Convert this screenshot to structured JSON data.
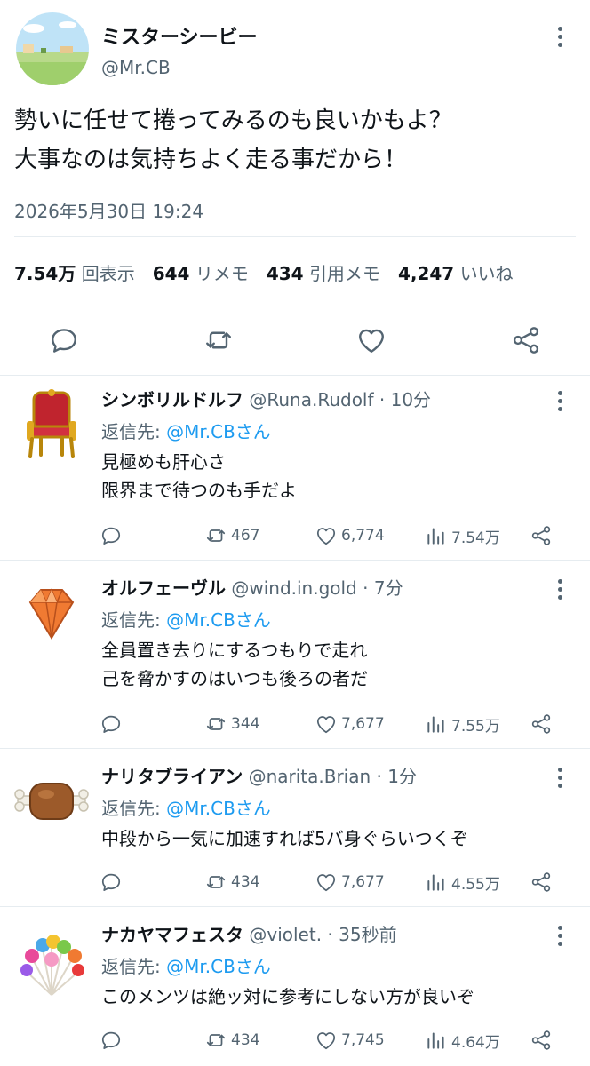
{
  "main": {
    "name": "ミスターシービー",
    "handle": "@Mr.CB",
    "lines": [
      "勢いに任せて捲ってみるのも良いかもよ？",
      "大事なのは気持ちよく走る事だから！"
    ],
    "timestamp": "2026年5月30日 19:24",
    "stats": {
      "views": "7.54万",
      "views_label": "回表示",
      "reposts": "644",
      "reposts_label": "リメモ",
      "quotes": "434",
      "quotes_label": "引用メモ",
      "likes": "4,247",
      "likes_label": "いいね"
    }
  },
  "replies": [
    {
      "name": "シンボリルドルフ",
      "handle": "@Runa.Rudolf",
      "time": "10分",
      "to_prefix": "返信先: ",
      "to": "@Mr.CBさん",
      "lines": [
        "見極めも肝心さ",
        "限界まで待つのも手だよ"
      ],
      "reposts": "467",
      "likes": "6,774",
      "views": "7.54万"
    },
    {
      "name": "オルフェーヴル",
      "handle": "@wind.in.gold",
      "time": "7分",
      "to_prefix": "返信先: ",
      "to": "@Mr.CBさん",
      "lines": [
        "全員置き去りにするつもりで走れ",
        "己を脅かすのはいつも後ろの者だ"
      ],
      "reposts": "344",
      "likes": "7,677",
      "views": "7.55万"
    },
    {
      "name": "ナリタブライアン",
      "handle": "@narita.Brian",
      "time": "1分",
      "to_prefix": "返信先: ",
      "to": "@Mr.CBさん",
      "lines": [
        "中段から一気に加速すれば5バ身ぐらいつくぞ"
      ],
      "reposts": "434",
      "likes": "7,677",
      "views": "4.55万"
    },
    {
      "name": "ナカヤマフェスタ",
      "handle": "@violet.",
      "time": "35秒前",
      "to_prefix": "返信先: ",
      "to": "@Mr.CBさん",
      "lines": [
        "このメンツは絶ッ対に参考にしない方が良いぞ"
      ],
      "reposts": "434",
      "likes": "7,745",
      "views": "4.64万"
    }
  ],
  "icons": {
    "more": "more-vertical-icon",
    "reply": "reply-icon",
    "repost": "repost-icon",
    "like": "heart-icon",
    "views": "views-bar-icon",
    "share": "share-icon"
  },
  "colors": {
    "accent": "#1d9bf0",
    "muted": "#536471",
    "text": "#0f1419",
    "divider": "#e6ecf0"
  }
}
